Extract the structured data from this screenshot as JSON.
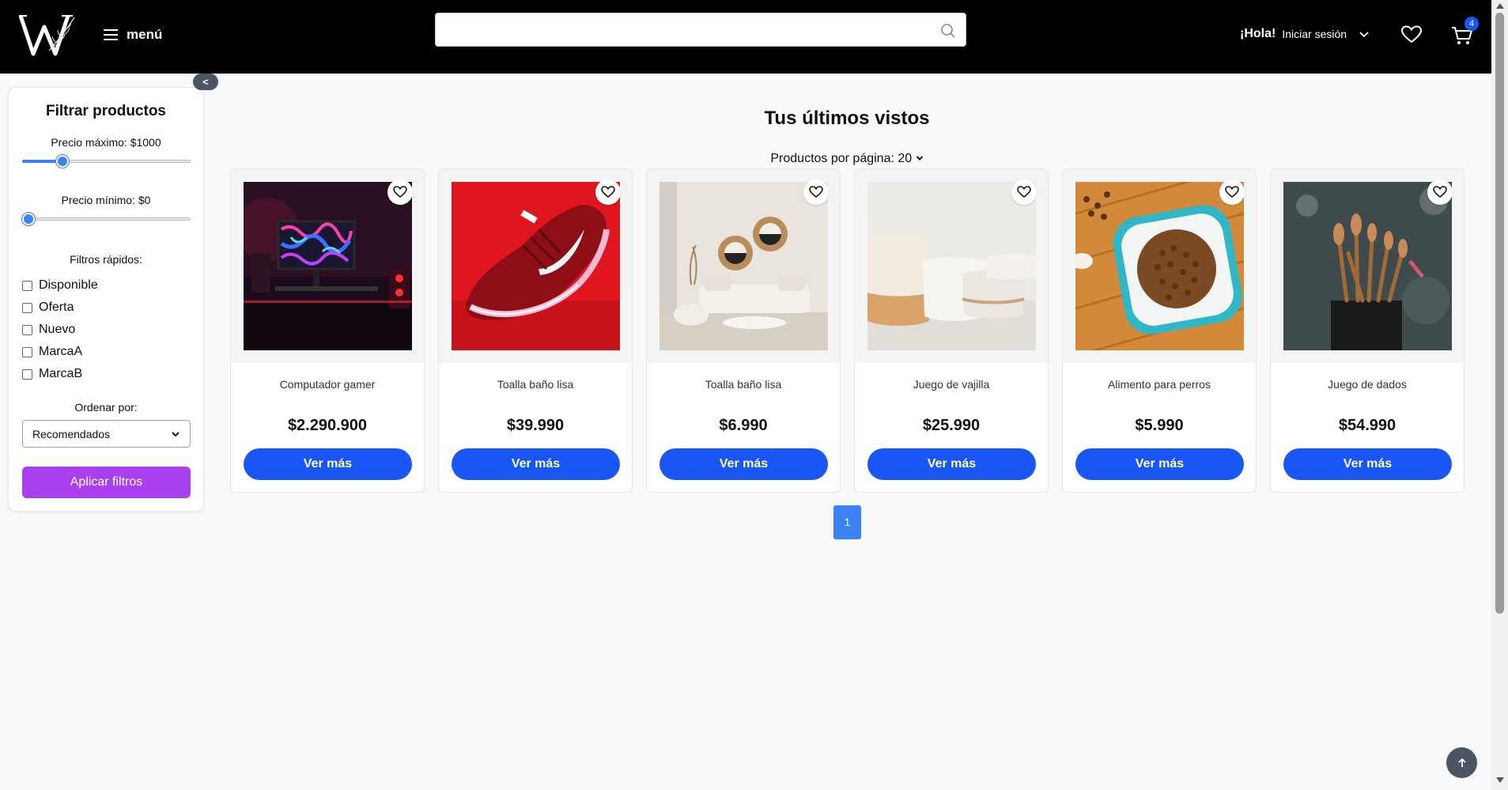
{
  "header": {
    "logo_alt": "W",
    "menu_label": "menú",
    "search_value": "",
    "greeting": "¡Hola!",
    "login_label": "Iniciar sesión",
    "cart_count": "4",
    "accent": "#1a56f5"
  },
  "sidebar": {
    "collapse_label": "<",
    "title": "Filtrar productos",
    "max_price_label": "Precio máximo: $1000",
    "max_price_fraction": 0.22,
    "min_price_label": "Precio mínimo: $0",
    "min_price_fraction": 0.0,
    "quick_filters_label": "Filtros rápidos:",
    "quick_filters": [
      "Disponible",
      "Oferta",
      "Nuevo",
      "MarcaA",
      "MarcaB"
    ],
    "order_label": "Ordenar por:",
    "order_value": "Recomendados",
    "apply_label": "Aplicar filtros",
    "apply_color": "#a93fee"
  },
  "main": {
    "title": "Tus últimos vistos",
    "per_page_label": "Productos por página: 20",
    "products": [
      {
        "name": "Computador gamer",
        "price": "$2.290.900",
        "button": "Ver más",
        "image": "gaming-pc-photo"
      },
      {
        "name": "Toalla baño lisa",
        "price": "$39.990",
        "button": "Ver más",
        "image": "red-sneaker-photo"
      },
      {
        "name": "Toalla baño lisa",
        "price": "$6.990",
        "button": "Ver más",
        "image": "living-room-photo"
      },
      {
        "name": "Juego de vajilla",
        "price": "$25.990",
        "button": "Ver más",
        "image": "ceramic-cups-photo"
      },
      {
        "name": "Alimento para perros",
        "price": "$5.990",
        "button": "Ver más",
        "image": "dog-food-bowl-photo"
      },
      {
        "name": "Juego de dados",
        "price": "$54.990",
        "button": "Ver más",
        "image": "makeup-brushes-photo"
      }
    ],
    "current_page": "1"
  }
}
